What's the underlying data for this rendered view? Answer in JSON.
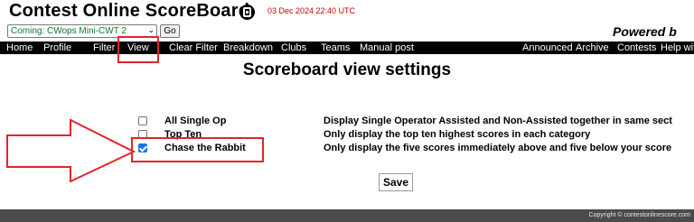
{
  "header": {
    "site_title": "Contest Online ScoreBoard",
    "timestamp": "03 Dec 2024 22:40 UTC",
    "contest_select_value": "Coming: CWops Mini-CWT 2",
    "go_label": "Go",
    "powered_by": "Powered b"
  },
  "nav": {
    "home": "Home",
    "profile": "Profile",
    "filter": "Filter",
    "view": "View",
    "clear_filter": "Clear Filter",
    "breakdown": "Breakdown",
    "clubs": "Clubs",
    "teams": "Teams",
    "manual_post": "Manual post",
    "announced": "Announced",
    "archive": "Archive",
    "contests": "Contests",
    "help": "Help wit"
  },
  "main": {
    "title": "Scoreboard view settings",
    "options": [
      {
        "label": "All Single Op",
        "checked": false,
        "description": "Display Single Operator Assisted and Non-Assisted together in same sect"
      },
      {
        "label": "Top Ten",
        "checked": false,
        "description": "Only display the top ten highest scores in each category"
      },
      {
        "label": "Chase the Rabbit",
        "checked": true,
        "description": "Only display the five scores immediately above and five below your score"
      }
    ],
    "save_label": "Save"
  },
  "footer": {
    "copyright": "Copyright © contestonlinescore.com"
  },
  "colors": {
    "accent_red": "#e3242b",
    "timestamp_red": "#cc0000",
    "select_text_green": "#117733",
    "checkbox_blue": "#1a73e8",
    "navbar_bg": "#000000",
    "footer_bg": "#4a4a4a"
  },
  "icons": {
    "phone": "phone-icon",
    "dropdown": "chevron-down-icon",
    "annotation_arrow": "arrow-right-icon"
  }
}
